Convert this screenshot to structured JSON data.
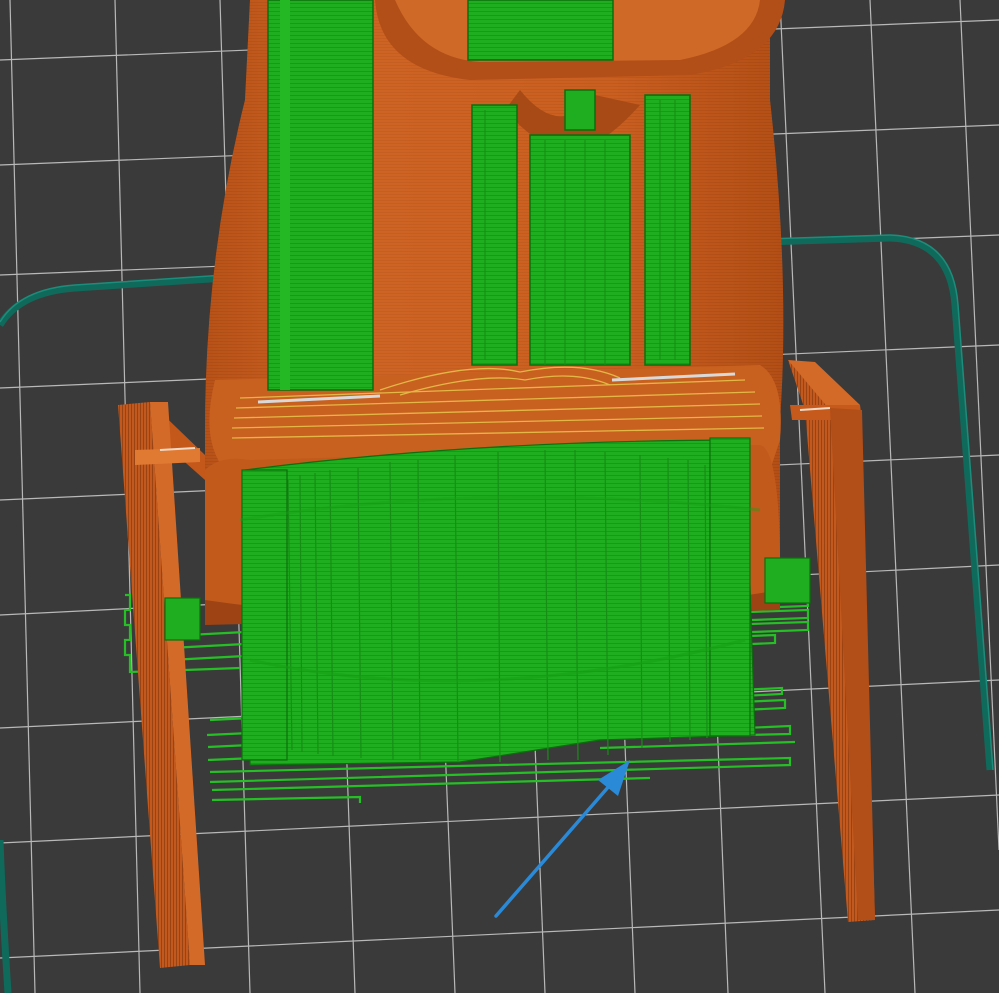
{
  "app": {
    "view": "3d-slicer-preview",
    "object": "sliced-model-with-supports"
  },
  "colors": {
    "bed_background": "#3a3a3a",
    "grid_line": "#cfcfcf",
    "skirt": "#0f6a5c",
    "perimeter": "#c55a1c",
    "perimeter_dark": "#9c4313",
    "perimeter_light": "#e07a33",
    "support": "#1fae1f",
    "support_dark": "#168e16",
    "support_edge": "#0c6e0c",
    "infill_accent": "#e8d44a",
    "arrow": "#2a8ad8"
  },
  "icons": {
    "annotation": "arrow-icon"
  }
}
